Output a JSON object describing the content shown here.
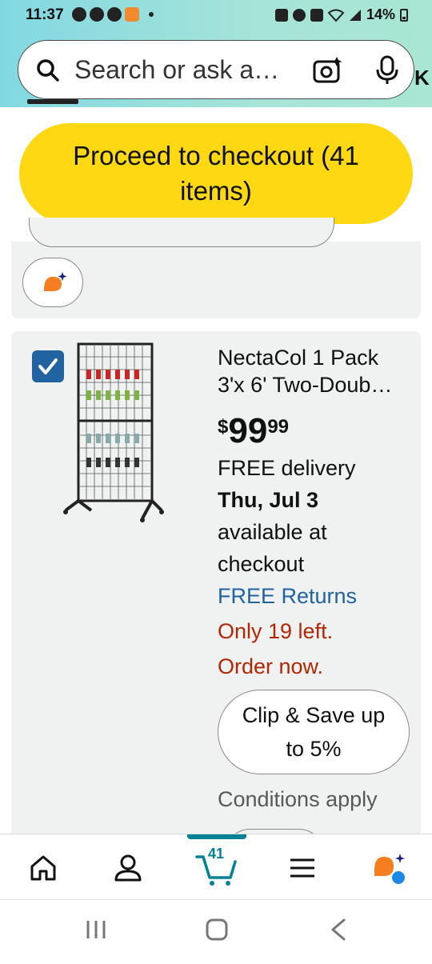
{
  "status_bar": {
    "time": "11:37",
    "battery": "14%"
  },
  "search": {
    "placeholder": "Search or ask a…",
    "trailing_letter": "K"
  },
  "checkout": {
    "label": "Proceed to checkout (41 items)"
  },
  "product": {
    "checked": true,
    "title": "NectaCol 1 Pack 3'x 6' Two-Doub…",
    "price_currency": "$",
    "price_whole": "99",
    "price_cents": "99",
    "delivery_prefix": "FREE delivery",
    "delivery_date": "Thu, Jul 3",
    "availability_line1": "available at",
    "availability_line2": "checkout",
    "returns": "FREE Returns",
    "stock_line1": "Only 19 left.",
    "stock_line2": "Order now.",
    "coupon": "Clip & Save up to 5%",
    "conditions": "Conditions apply"
  },
  "bottom_nav": {
    "cart_count": "41",
    "accent_color": "#008296"
  },
  "colors": {
    "checkout_yellow": "#ffd814",
    "link_blue": "#2162a1",
    "urgent_red": "#b12704"
  }
}
